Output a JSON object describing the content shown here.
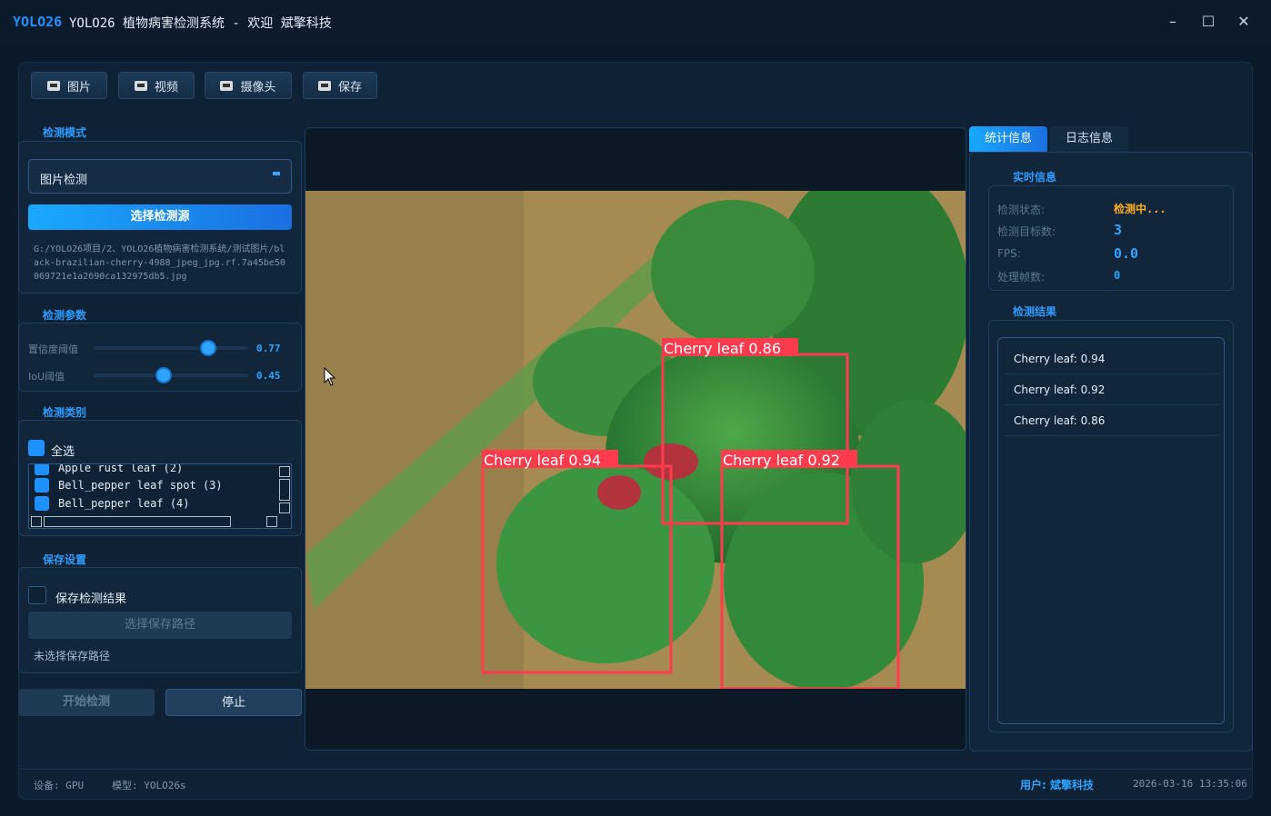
{
  "titlebar": {
    "logo": "YOLO26",
    "title": "YOLO26 植物病害检测系统 - 欢迎 斌擎科技",
    "minimize": "–",
    "maximize": "☐",
    "close": "✕"
  },
  "toolbar": {
    "image_label": "图片",
    "video_label": "视频",
    "camera_label": "摄像头",
    "save_label": "保存"
  },
  "left_panel": {
    "mode_section_title": "检测模式",
    "mode_selected": "图片检测",
    "select_source_label": "选择检测源",
    "source_path": "G:/YOLO26项目/2、YOLO26植物病害检测系统/测试图片/black-brazilian-cherry-4988_jpeg_jpg.rf.7a45be50069721e1a2690ca132975db5.jpg",
    "params_section_title": "检测参数",
    "conf_label": "置信度阈值",
    "conf_value": "0.77",
    "conf_fraction": 0.77,
    "iou_label": "IoU阈值",
    "iou_value": "0.45",
    "iou_fraction": 0.45,
    "classes_section_title": "检测类别",
    "select_all_label": "全选",
    "class_items": [
      "Apple rust leaf (2)",
      "Bell_pepper leaf spot (3)",
      "Bell_pepper leaf (4)"
    ],
    "save_section_title": "保存设置",
    "save_result_label": "保存检测结果",
    "choose_save_path_label": "选择保存路径",
    "save_path_status": "未选择保存路径",
    "start_label": "开始检测",
    "stop_label": "停止"
  },
  "detection": {
    "boxes": [
      {
        "label": "Cherry leaf 0.86",
        "color": "#ff3b4e"
      },
      {
        "label": "Cherry leaf 0.94",
        "color": "#ff3b4e"
      },
      {
        "label": "Cherry leaf 0.92",
        "color": "#ff3b4e"
      }
    ]
  },
  "right_panel": {
    "tab_stats": "统计信息",
    "tab_log": "日志信息",
    "realtime_title": "实时信息",
    "status_label": "检测状态:",
    "status_value": "检测中...",
    "count_label": "检测目标数:",
    "count_value": "3",
    "fps_label": "FPS:",
    "fps_value": "0.0",
    "frames_label": "处理帧数:",
    "frames_value": "0",
    "results_title": "检测结果",
    "results": [
      "Cherry leaf: 0.94",
      "Cherry leaf: 0.92",
      "Cherry leaf: 0.86"
    ]
  },
  "statusbar": {
    "device": "设备: GPU",
    "model": "模型: YOLO26s",
    "user": "用户: 斌擎科技",
    "datetime": "2026-03-16 13:35:06"
  },
  "colors": {
    "accent": "#1e90ff",
    "status_warning": "#ffb020",
    "box": "#ff3b4e"
  }
}
